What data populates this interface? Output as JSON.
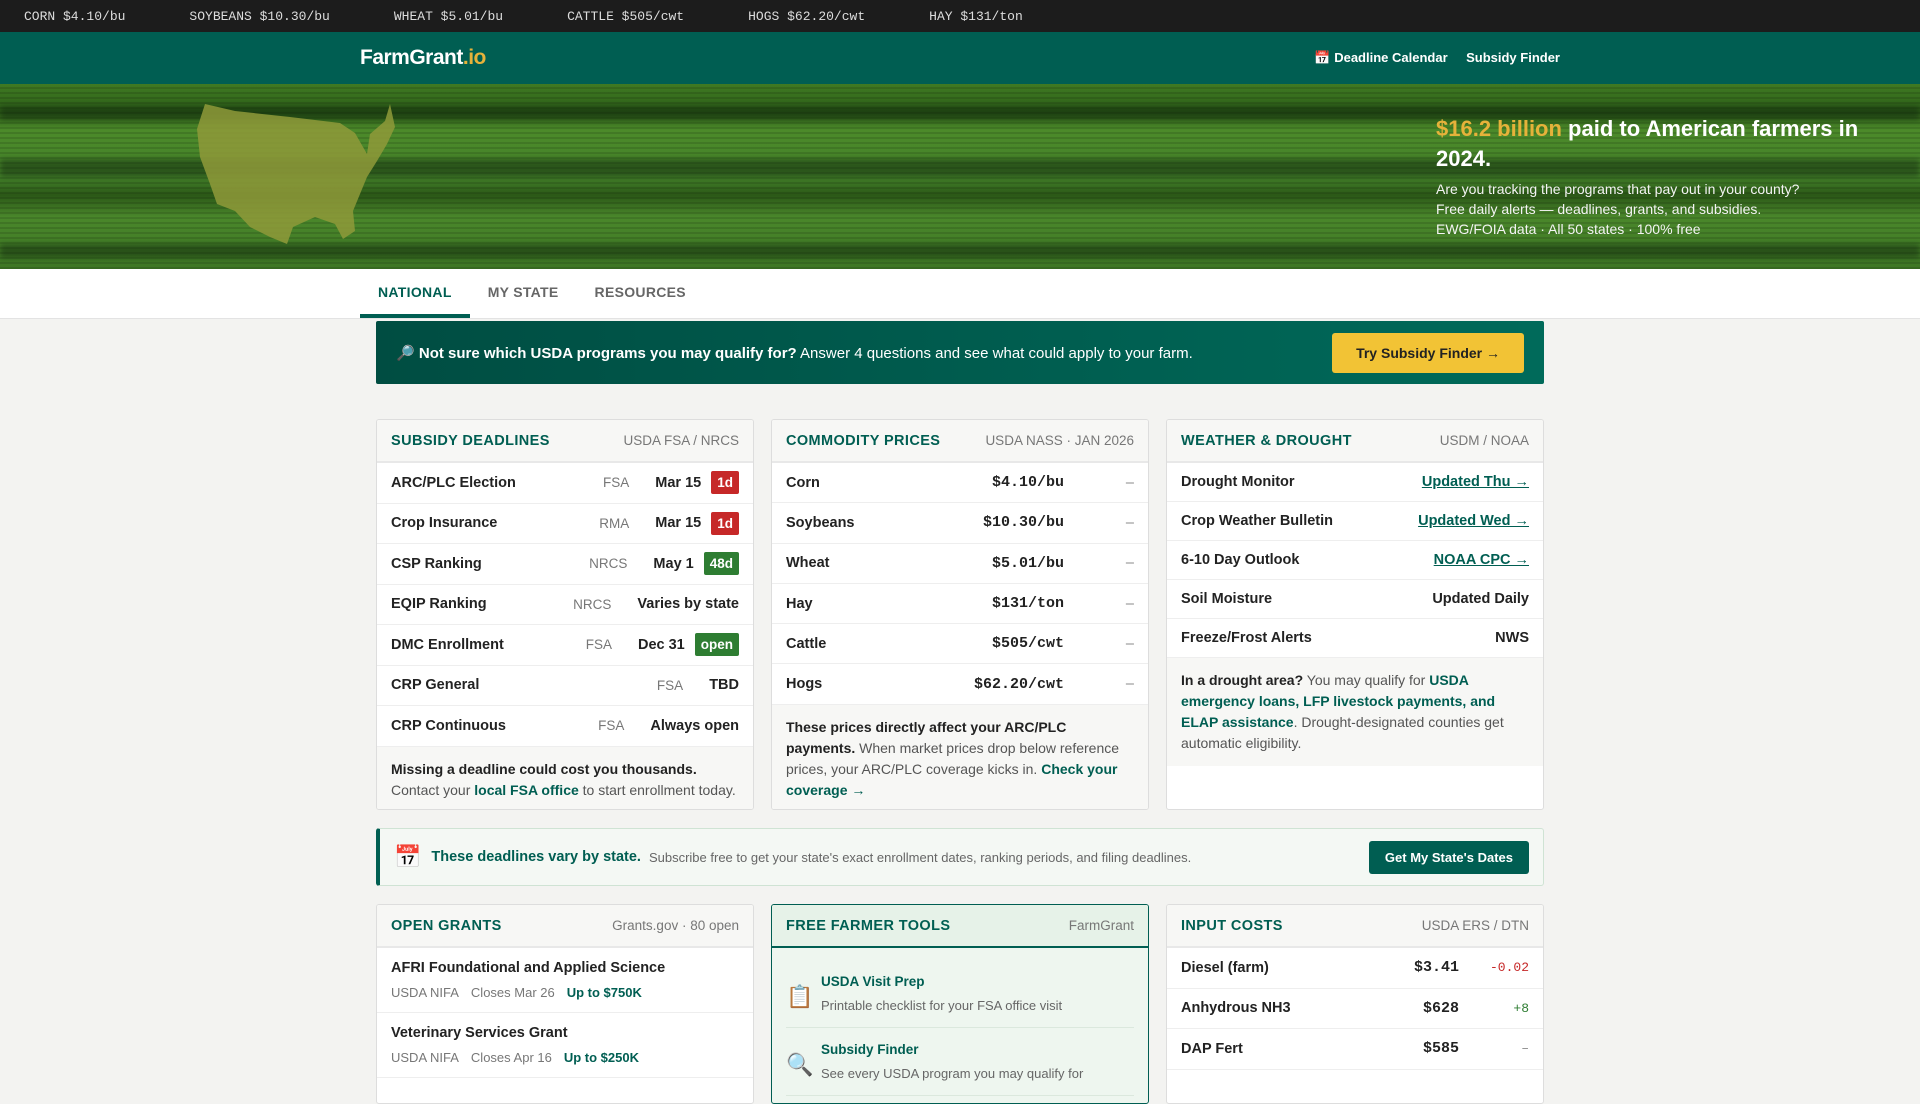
{
  "ticker": [
    "CORN $4.10/bu",
    "SOYBEANS $10.30/bu",
    "WHEAT $5.01/bu",
    "CATTLE $505/cwt",
    "HOGS $62.20/cwt",
    "HAY $131/ton"
  ],
  "header": {
    "logo_main": "FarmGrant",
    "logo_suffix": ".io",
    "nav": [
      {
        "icon": "calendar-icon",
        "glyph": "📅",
        "label": "Deadline Calendar"
      },
      {
        "label": "Subsidy Finder"
      }
    ]
  },
  "hero": {
    "highlight": "$16.2 billion",
    "title_rest": " paid to American farmers in 2024.",
    "lines": [
      "Are you tracking the programs that pay out in your county?",
      "Free daily alerts — deadlines, grants, and subsidies.",
      "EWG/FOIA data · All 50 states · 100% free"
    ]
  },
  "tabs": [
    "NATIONAL",
    "MY STATE",
    "RESOURCES"
  ],
  "promo": {
    "icon": "🔎",
    "bold": "Not sure which USDA programs you may qualify for?",
    "text": " Answer 4 questions and see what could apply to your farm.",
    "button": "Try Subsidy Finder →"
  },
  "deadlines": {
    "title": "SUBSIDY DEADLINES",
    "source": "USDA FSA / NRCS",
    "rows": [
      {
        "name": "ARC/PLC Election",
        "agency": "FSA",
        "date": "Mar 15",
        "badge": "1d",
        "color": "red"
      },
      {
        "name": "Crop Insurance",
        "agency": "RMA",
        "date": "Mar 15",
        "badge": "1d",
        "color": "red"
      },
      {
        "name": "CSP Ranking",
        "agency": "NRCS",
        "date": "May 1",
        "badge": "48d",
        "color": "green"
      },
      {
        "name": "EQIP Ranking",
        "agency": "NRCS",
        "date": "Varies by state",
        "badge": null
      },
      {
        "name": "DMC Enrollment",
        "agency": "FSA",
        "date": "Dec 31",
        "badge": "open",
        "color": "green"
      },
      {
        "name": "CRP General",
        "agency": "FSA",
        "date": "TBD",
        "badge": null
      },
      {
        "name": "CRP Continuous",
        "agency": "FSA",
        "date": "Always open",
        "badge": null
      }
    ],
    "note_bold": "Missing a deadline could cost you thousands.",
    "note_pre": "Contact your ",
    "note_link": "local FSA office",
    "note_post": " to start enrollment today."
  },
  "prices": {
    "title": "COMMODITY PRICES",
    "source": "USDA NASS · JAN 2026",
    "rows": [
      {
        "name": "Corn",
        "price": "$4.10/bu",
        "change": "–"
      },
      {
        "name": "Soybeans",
        "price": "$10.30/bu",
        "change": "–"
      },
      {
        "name": "Wheat",
        "price": "$5.01/bu",
        "change": "–"
      },
      {
        "name": "Hay",
        "price": "$131/ton",
        "change": "–"
      },
      {
        "name": "Cattle",
        "price": "$505/cwt",
        "change": "–"
      },
      {
        "name": "Hogs",
        "price": "$62.20/cwt",
        "change": "–"
      }
    ],
    "note_bold": "These prices directly affect your ARC/PLC payments.",
    "note_text": " When market prices drop below reference prices, your ARC/PLC coverage kicks in. ",
    "note_link": "Check your coverage →"
  },
  "weather": {
    "title": "WEATHER & DROUGHT",
    "source": "USDM / NOAA",
    "rows": [
      {
        "name": "Drought Monitor",
        "value": "Updated Thu →",
        "link": true
      },
      {
        "name": "Crop Weather Bulletin",
        "value": "Updated Wed →",
        "link": true
      },
      {
        "name": "6-10 Day Outlook",
        "value": "NOAA CPC →",
        "link": true
      },
      {
        "name": "Soil Moisture",
        "value": "Updated Daily",
        "link": false
      },
      {
        "name": "Freeze/Frost Alerts",
        "value": "NWS",
        "link": false
      }
    ],
    "note_bold": "In a drought area?",
    "note_pre": " You may qualify for ",
    "note_link": "USDA emergency loans, LFP livestock payments, and ELAP assistance",
    "note_post": ". Drought-designated counties get automatic eligibility."
  },
  "state_banner": {
    "icon": "📅",
    "title": "These deadlines vary by state.",
    "text": "Subscribe free to get your state's exact enrollment dates, ranking periods, and filing deadlines.",
    "button": "Get My State's Dates"
  },
  "grants": {
    "title": "OPEN GRANTS",
    "source": "Grants.gov · 80 open",
    "rows": [
      {
        "name": "AFRI Foundational and Applied Science",
        "agency": "USDA NIFA",
        "closes": "Closes Mar 26",
        "amount": "Up to $750K"
      },
      {
        "name": "Veterinary Services Grant",
        "agency": "USDA NIFA",
        "closes": "Closes Apr 16",
        "amount": "Up to $250K"
      }
    ]
  },
  "tools": {
    "title": "FREE FARMER TOOLS",
    "source": "FarmGrant",
    "rows": [
      {
        "icon": "📋",
        "name": "USDA Visit Prep",
        "desc": "Printable checklist for your FSA office visit"
      },
      {
        "icon": "🔍",
        "name": "Subsidy Finder",
        "desc": "See every USDA program you may qualify for"
      }
    ]
  },
  "inputs": {
    "title": "INPUT COSTS",
    "source": "USDA ERS / DTN",
    "rows": [
      {
        "name": "Diesel (farm)",
        "price": "$3.41",
        "change": "-0.02",
        "dir": "down"
      },
      {
        "name": "Anhydrous NH3",
        "price": "$628",
        "change": "+8",
        "dir": "up"
      },
      {
        "name": "DAP Fert",
        "price": "$585",
        "change": "–",
        "dir": "flat"
      }
    ]
  }
}
